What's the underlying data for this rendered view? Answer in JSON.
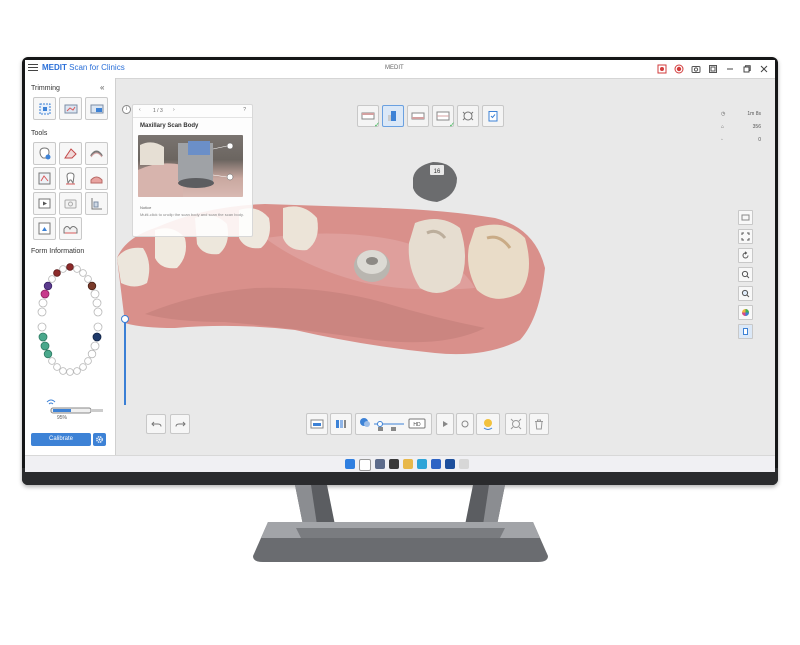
{
  "app": {
    "brand": "MEDIT",
    "product": "Scan for Clinics",
    "window_title": "MEDIT"
  },
  "left_panel": {
    "trimming_title": "Trimming",
    "collapse_glyph": "«",
    "tools_title": "Tools",
    "form_title": "Form Information",
    "calibrate_label": "Calibrate",
    "calib_percent": "95%"
  },
  "guide": {
    "page": "1 / 3",
    "title": "Maxillary Scan Body",
    "notice": "Notice",
    "description": "Multi-click to unclip the scan body and scan the scan body."
  },
  "right_info": {
    "time": "1m 8s",
    "count": "356",
    "zero": "0"
  },
  "tooth_marker": "16",
  "colors": {
    "accent": "#3d82d6",
    "brand": "#2a6fd8",
    "gum": "#d98c88",
    "check": "#2db34a"
  },
  "icons": [
    "menu-icon",
    "record-icon",
    "screenshot-icon",
    "minimize-icon",
    "maximize-icon",
    "close-icon",
    "gear-icon",
    "undo-icon",
    "redo-icon",
    "play-icon",
    "trash-icon",
    "zoom-icon",
    "rotate-icon",
    "fit-icon",
    "color-icon"
  ]
}
